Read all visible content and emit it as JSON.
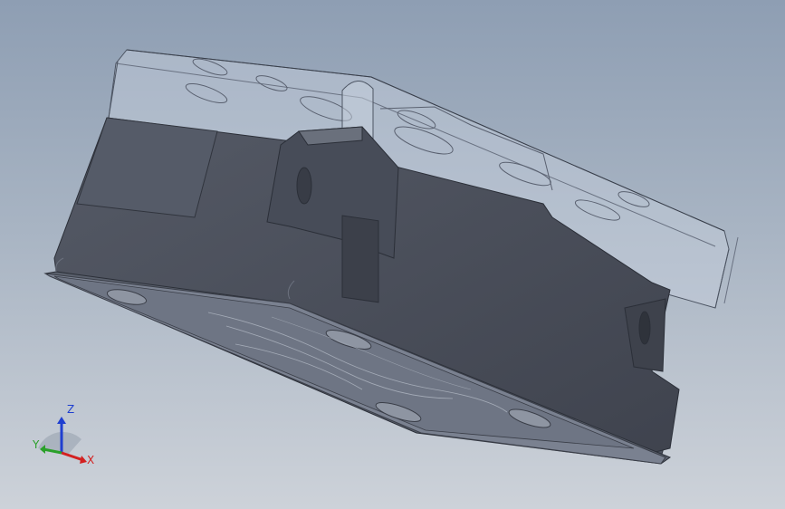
{
  "viewport": {
    "background_top": "#8e9eb3",
    "background_bottom": "#cdd2d9",
    "part_color": "#4a4f5c",
    "transparent_cover_color": "#b9c4d2"
  },
  "triad": {
    "x_label": "X",
    "y_label": "Y",
    "z_label": "Z",
    "x_color": "#d32020",
    "y_color": "#2aa02a",
    "z_color": "#1f3fd0"
  }
}
